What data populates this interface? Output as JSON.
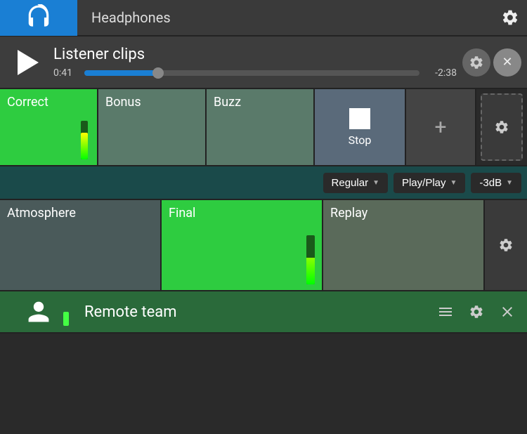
{
  "headphones": {
    "label": "Headphones",
    "icon": "🎧"
  },
  "listener": {
    "title": "Listener clips",
    "time_elapsed": "0:41",
    "time_remaining": "-2:38",
    "progress_percent": 22
  },
  "sound_buttons": {
    "correct": "Correct",
    "bonus": "Bonus",
    "buzz": "Buzz",
    "stop": "Stop",
    "add": "+"
  },
  "controls": {
    "mode": "Regular",
    "play_mode": "Play/Play",
    "volume": "-3dB"
  },
  "media": {
    "atmosphere": "Atmosphere",
    "final": "Final",
    "replay": "Replay"
  },
  "remote": {
    "label": "Remote team"
  }
}
